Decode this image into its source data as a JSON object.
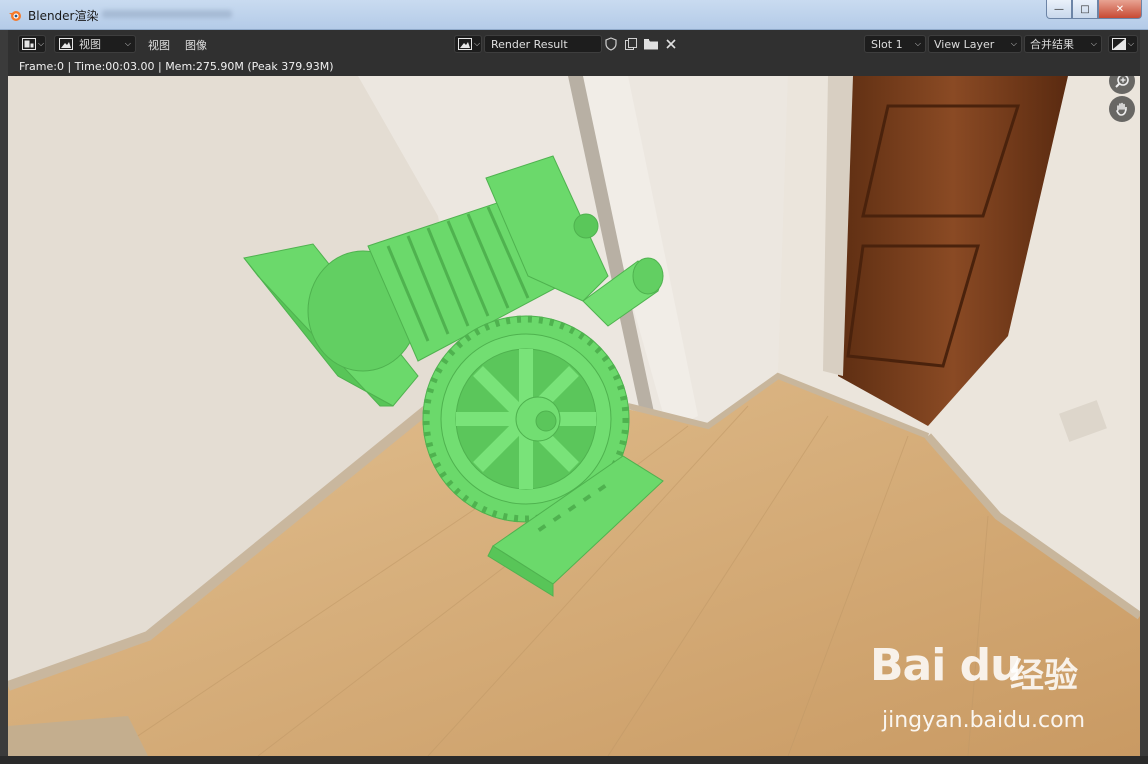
{
  "window": {
    "title": "Blender渲染",
    "app_icon": "blender-icon",
    "buttons": {
      "minimize": "—",
      "maximize": "□",
      "close": "✕"
    }
  },
  "header": {
    "editor_type_icon": "image-editor-icon",
    "view_mode": "视图",
    "menus": [
      "视图",
      "图像"
    ],
    "image_icon": "image-icon",
    "image_name": "Render Result",
    "icons": [
      "fake-user-shield-icon",
      "duplicate-icon",
      "folder-icon",
      "close-icon"
    ],
    "slot": "Slot 1",
    "view_layer": "View Layer",
    "pass": "合并结果",
    "display_icon": "display-channels-icon"
  },
  "info": {
    "text": "Frame:0 | Time:00:03.00 | Mem:275.90M (Peak 379.93M)"
  },
  "viewport": {
    "nav_icons": [
      "zoom-icon",
      "pan-hand-icon"
    ],
    "render_color": "#6bd96b",
    "floor_color": "#d8b07e",
    "wall_color": "#e9e3da",
    "door_color": "#7a3f1c"
  },
  "watermark": {
    "logo": "Bai du",
    "cn": "经验",
    "url": "jingyan.baidu.com"
  }
}
